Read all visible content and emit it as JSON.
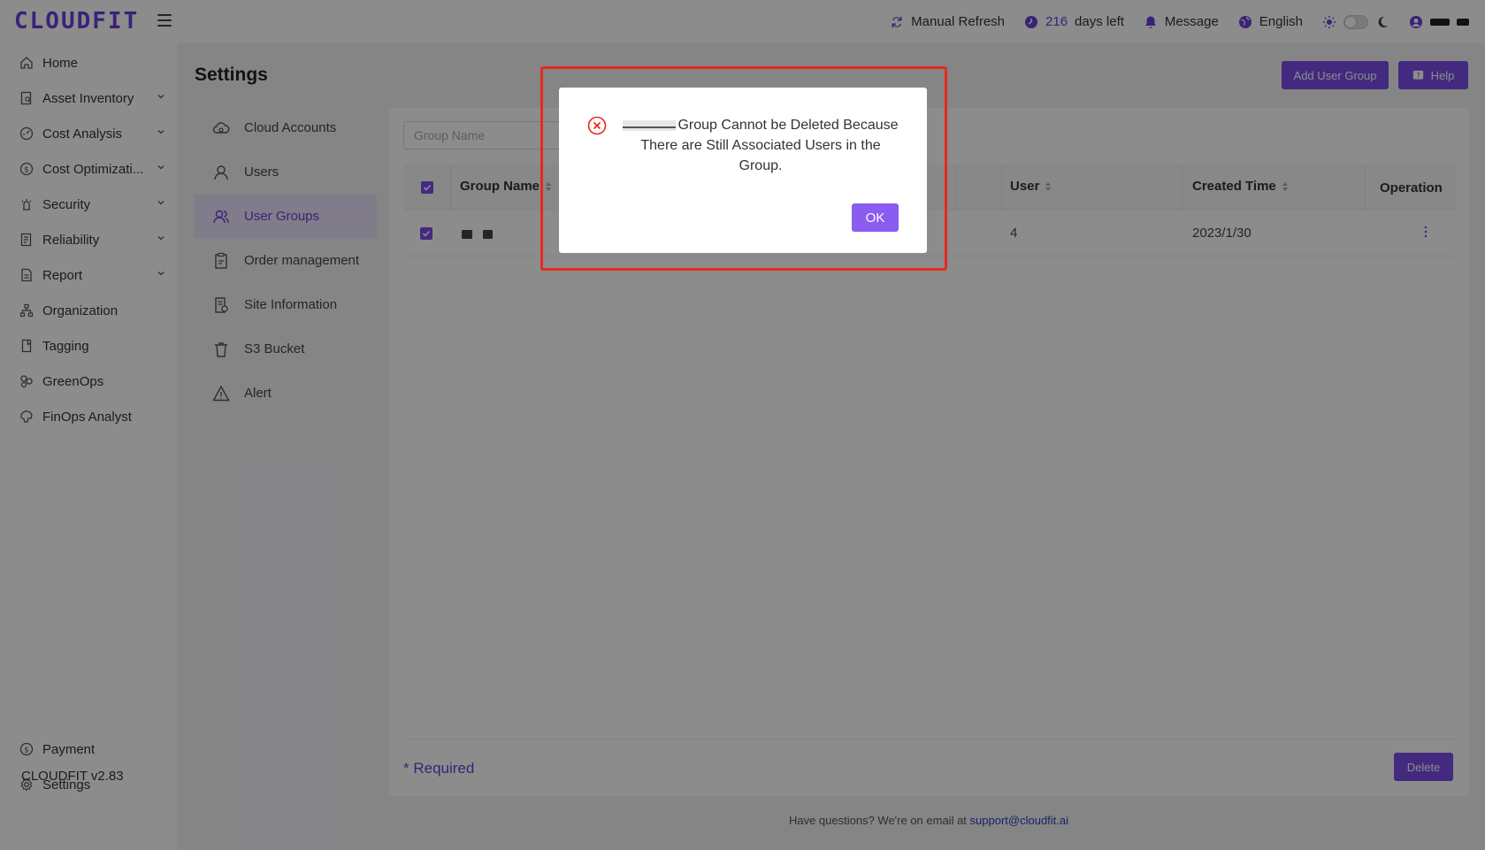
{
  "app": {
    "logo": "CLOUDFIT",
    "version": "CLOUDFIT v2.83"
  },
  "topbar": {
    "refresh_label": "Manual Refresh",
    "days_count": "216",
    "days_suffix": "days left",
    "message_label": "Message",
    "language_label": "English"
  },
  "sidebar": {
    "items": [
      {
        "label": "Home",
        "icon": "home-icon"
      },
      {
        "label": "Asset Inventory",
        "icon": "asset-icon",
        "expandable": true
      },
      {
        "label": "Cost Analysis",
        "icon": "cost-analysis-icon",
        "expandable": true
      },
      {
        "label": "Cost Optimizati...",
        "icon": "cost-optimization-icon",
        "expandable": true
      },
      {
        "label": "Security",
        "icon": "security-icon",
        "expandable": true
      },
      {
        "label": "Reliability",
        "icon": "reliability-icon",
        "expandable": true
      },
      {
        "label": "Report",
        "icon": "report-icon",
        "expandable": true
      },
      {
        "label": "Organization",
        "icon": "organization-icon"
      },
      {
        "label": "Tagging",
        "icon": "tag-icon"
      },
      {
        "label": "GreenOps",
        "icon": "leaf-icon"
      },
      {
        "label": "FinOps Analyst",
        "icon": "analyst-icon"
      }
    ],
    "bottom": [
      {
        "label": "Payment",
        "icon": "payment-icon"
      },
      {
        "label": "Settings",
        "icon": "gear-icon"
      }
    ]
  },
  "settings": {
    "title": "Settings",
    "menu": [
      {
        "label": "Cloud Accounts",
        "icon": "cloud-icon"
      },
      {
        "label": "Users",
        "icon": "user-icon"
      },
      {
        "label": "User Groups",
        "icon": "user-group-icon",
        "active": true
      },
      {
        "label": "Order management",
        "icon": "order-icon"
      },
      {
        "label": "Site Information",
        "icon": "site-info-icon"
      },
      {
        "label": "S3 Bucket",
        "icon": "bucket-icon"
      },
      {
        "label": "Alert",
        "icon": "alert-icon"
      }
    ],
    "add_button": "Add User Group",
    "help_button": "Help"
  },
  "table": {
    "search_placeholder": "Group Name",
    "columns": {
      "group_name": "Group Name",
      "user": "User",
      "created_time": "Created Time",
      "operation": "Operation"
    },
    "rows": [
      {
        "user": "4",
        "created_time": "2023/1/30"
      }
    ],
    "required_label": "* Required",
    "delete_button": "Delete"
  },
  "footer": {
    "text": "Have questions? We're on email at",
    "email": "support@cloudfit.ai"
  },
  "modal": {
    "message": "Group Cannot be Deleted Because There are Still Associated Users in the Group.",
    "ok_button": "OK"
  },
  "colors": {
    "accent": "#7b4ee8",
    "error": "#e8281f",
    "highlight_border": "#e8281f"
  }
}
